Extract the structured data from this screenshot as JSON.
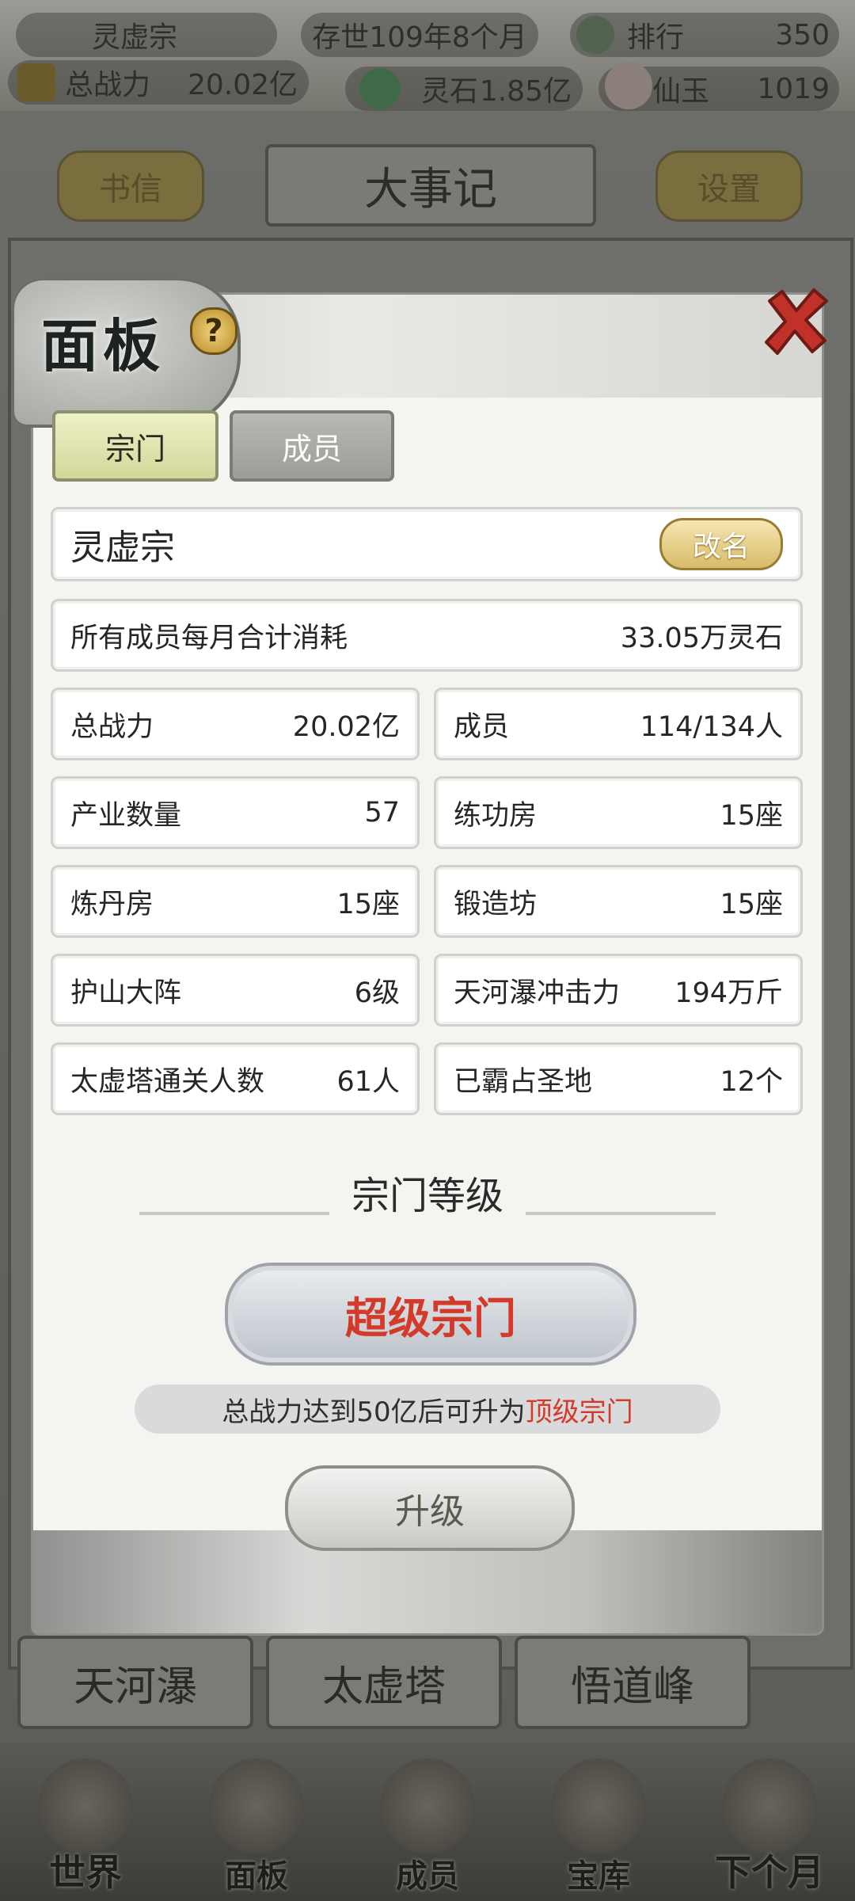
{
  "header": {
    "sect_name": "灵虚宗",
    "age": "存世109年8个月",
    "rank_label": "排行",
    "rank_value": "350",
    "power_label": "总战力",
    "power_value": "20.02亿",
    "spirit_stone_label": "灵石",
    "spirit_stone_value": "1.85亿",
    "jade_label": "仙玉",
    "jade_value": "1019"
  },
  "background": {
    "letters_button": "书信",
    "title": "大事记",
    "settings_button": "设置",
    "places": [
      "天河瀑",
      "太虚塔",
      "悟道峰"
    ]
  },
  "bottom_nav": [
    "世界",
    "面板",
    "成员",
    "宝库",
    "下个月"
  ],
  "panel": {
    "title": "面板",
    "help_icon": "?",
    "tabs": [
      "宗门",
      "成员"
    ],
    "sect_name": "灵虚宗",
    "rename_button": "改名",
    "monthly_cost_label": "所有成员每月合计消耗",
    "monthly_cost_value": "33.05万灵石",
    "stats": [
      {
        "label": "总战力",
        "value": "20.02亿"
      },
      {
        "label": "成员",
        "value": "114/134人"
      },
      {
        "label": "产业数量",
        "value": "57"
      },
      {
        "label": "练功房",
        "value": "15座"
      },
      {
        "label": "炼丹房",
        "value": "15座"
      },
      {
        "label": "锻造坊",
        "value": "15座"
      },
      {
        "label": "护山大阵",
        "value": "6级"
      },
      {
        "label": "天河瀑冲击力",
        "value": "194万斤"
      },
      {
        "label": "太虚塔通关人数",
        "value": "61人"
      },
      {
        "label": "已霸占圣地",
        "value": "12个"
      }
    ],
    "level_heading": "宗门等级",
    "current_level": "超级宗门",
    "requirement_prefix": "总战力达到50亿后可升为",
    "requirement_next": "顶级宗门",
    "upgrade_button": "升级"
  },
  "colors": {
    "highlight_red": "#d43a2a",
    "rename_gold": "#d8ba6a",
    "active_tab": "#d4d79a"
  }
}
